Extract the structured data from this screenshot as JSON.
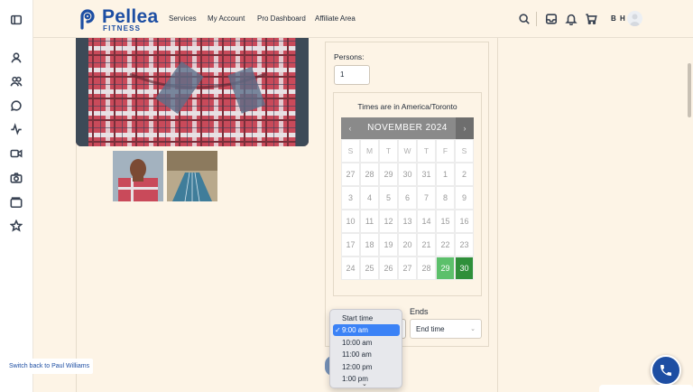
{
  "header": {
    "brand": "Pellea",
    "brand_sub": "FITNESS",
    "nav": [
      "Services",
      "My Account",
      "Pro Dashboard",
      "Affiliate Area"
    ],
    "initials": "B H"
  },
  "sidebar": {
    "icons": [
      "sidebar-toggle-icon",
      "user-icon",
      "users-icon",
      "chat-icon",
      "activity-icon",
      "video-icon",
      "camera-icon",
      "wallet-icon",
      "star-icon"
    ]
  },
  "booking": {
    "persons_label": "Persons:",
    "persons_value": "1",
    "timezone_note": "Times are in America/Toronto",
    "calendar": {
      "month": "NOVEMBER 2024",
      "prev": "‹",
      "next": "›",
      "weekdays": [
        "S",
        "M",
        "T",
        "W",
        "T",
        "F",
        "S"
      ],
      "days": [
        [
          "27",
          "28",
          "29",
          "30",
          "31",
          "1",
          "2"
        ],
        [
          "3",
          "4",
          "5",
          "6",
          "7",
          "8",
          "9"
        ],
        [
          "10",
          "11",
          "12",
          "13",
          "14",
          "15",
          "16"
        ],
        [
          "17",
          "18",
          "19",
          "20",
          "21",
          "22",
          "23"
        ],
        [
          "24",
          "25",
          "26",
          "27",
          "28",
          "29",
          "30"
        ]
      ],
      "available": [
        "29"
      ],
      "selected": "30"
    },
    "ends_label": "Ends",
    "ends_placeholder": "End time",
    "start_options": [
      "Start time",
      "9:00 am",
      "10:00 am",
      "11:00 am",
      "12:00 pm",
      "1:00 pm"
    ],
    "start_selected": "9:00 am"
  },
  "switch_back": "Switch back to Paul Williams",
  "colors": {
    "brand": "#1d4ea3",
    "available_day": "#5cc06b",
    "selected_day": "#2f8f3a",
    "background": "#fdf4e6"
  }
}
